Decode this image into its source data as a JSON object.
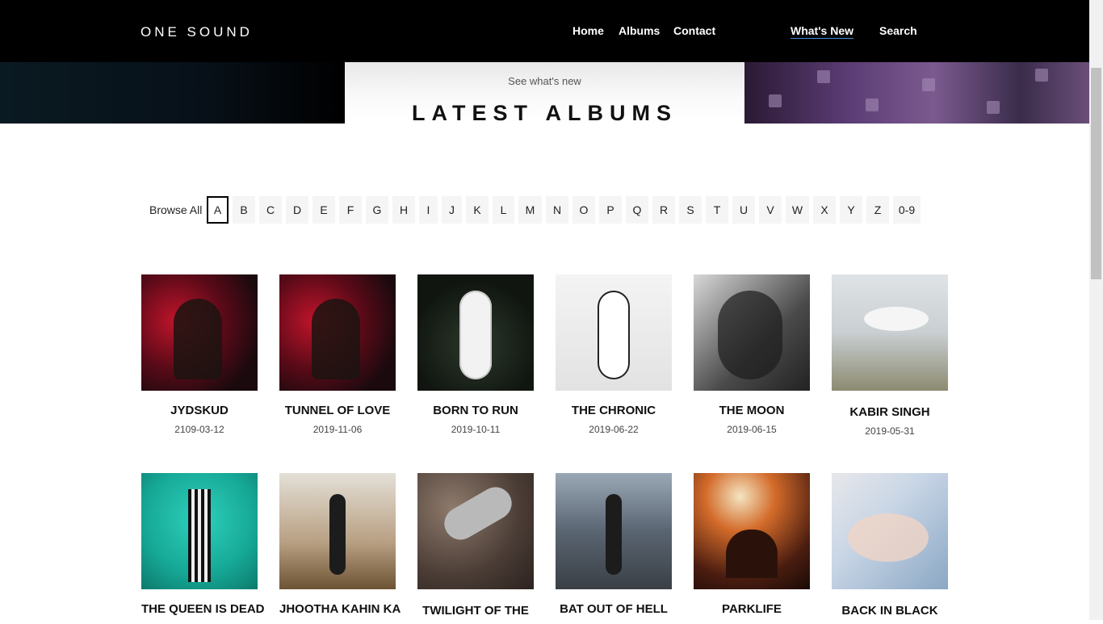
{
  "header": {
    "brand": "ONE SOUND",
    "nav": [
      "Home",
      "Albums",
      "Contact",
      "What's New",
      "Search"
    ]
  },
  "hero": {
    "subtitle": "See what's new",
    "title": "LATEST ALBUMS"
  },
  "browse": {
    "label": "Browse All",
    "letters": [
      "A",
      "B",
      "C",
      "D",
      "E",
      "F",
      "G",
      "H",
      "I",
      "J",
      "K",
      "L",
      "M",
      "N",
      "O",
      "P",
      "Q",
      "R",
      "S",
      "T",
      "U",
      "V",
      "W",
      "X",
      "Y",
      "Z",
      "0-9"
    ],
    "active": "A"
  },
  "albums": [
    {
      "title": "JYDSKUD",
      "date": "2109-03-12"
    },
    {
      "title": "TUNNEL OF LOVE",
      "date": "2019-11-06"
    },
    {
      "title": "BORN TO RUN",
      "date": "2019-10-11"
    },
    {
      "title": "THE CHRONIC",
      "date": "2019-06-22"
    },
    {
      "title": "THE MOON",
      "date": "2019-06-15"
    },
    {
      "title": "KABIR SINGH",
      "date": "2019-05-31"
    },
    {
      "title": "THE QUEEN IS DEAD",
      "date": ""
    },
    {
      "title": "JHOOTHA KAHIN KA",
      "date": ""
    },
    {
      "title": "TWILIGHT OF THE",
      "date": ""
    },
    {
      "title": "BAT OUT OF HELL",
      "date": ""
    },
    {
      "title": "PARKLIFE",
      "date": ""
    },
    {
      "title": "BACK IN BLACK",
      "date": ""
    }
  ]
}
